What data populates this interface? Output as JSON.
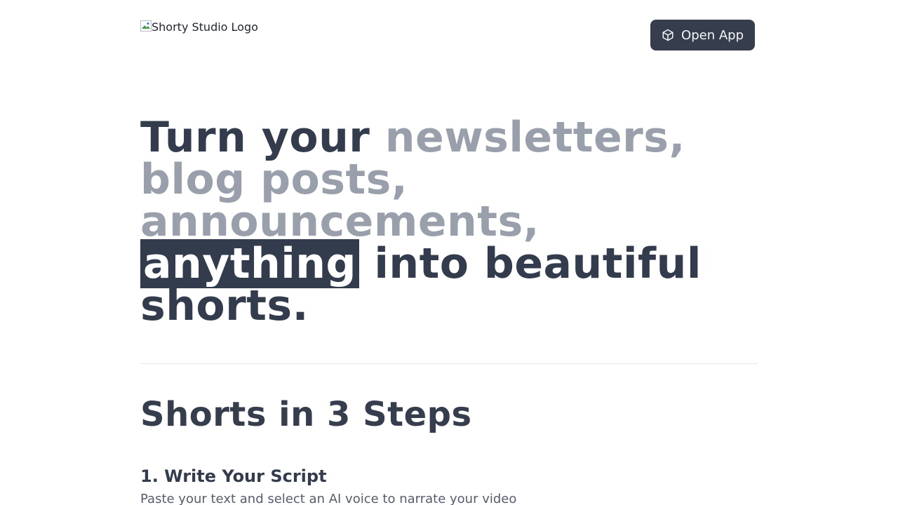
{
  "header": {
    "logo_alt": "Shorty Studio Logo",
    "open_app_label": "Open App",
    "open_app_icon": "cube-icon"
  },
  "hero": {
    "part1": "Turn your ",
    "muted1": "newsletters,",
    "muted2": "blog posts,",
    "muted3": "announcements,",
    "highlight": "anything",
    "part2": " into beautiful",
    "part3": "shorts."
  },
  "steps_section": {
    "title": "Shorts in 3 Steps",
    "steps": [
      {
        "title": "1. Write Your Script",
        "description": "Paste your text and select an AI voice to narrate your video"
      }
    ]
  },
  "colors": {
    "primary": "#333c4c",
    "muted": "#9aa0ab",
    "button_bg": "#363d4d"
  }
}
